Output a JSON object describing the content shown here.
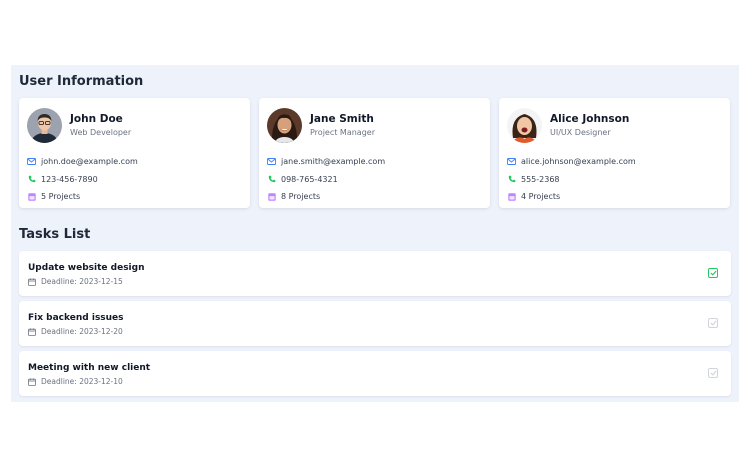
{
  "colors": {
    "panel_bg": "#eef2fb",
    "email_icon": "#3b82f6",
    "phone_icon": "#22c55e",
    "projects_icon": "#a855f7",
    "check_done": "#22c55e",
    "check_pending": "#d1d5db"
  },
  "users_section": {
    "title": "User Information"
  },
  "users": [
    {
      "name": "John Doe",
      "role": "Web Developer",
      "email": "john.doe@example.com",
      "phone": "123-456-7890",
      "projects": "5 Projects",
      "avatar_icon": "avatar-male-icon"
    },
    {
      "name": "Jane Smith",
      "role": "Project Manager",
      "email": "jane.smith@example.com",
      "phone": "098-765-4321",
      "projects": "8 Projects",
      "avatar_icon": "avatar-female-icon"
    },
    {
      "name": "Alice Johnson",
      "role": "UI/UX Designer",
      "email": "alice.johnson@example.com",
      "phone": "555-2368",
      "projects": "4 Projects",
      "avatar_icon": "avatar-female-icon"
    }
  ],
  "tasks_section": {
    "title": "Tasks List"
  },
  "tasks": [
    {
      "title": "Update website design",
      "deadline": "Deadline: 2023-12-15",
      "completed": true
    },
    {
      "title": "Fix backend issues",
      "deadline": "Deadline: 2023-12-20",
      "completed": false
    },
    {
      "title": "Meeting with new client",
      "deadline": "Deadline: 2023-12-10",
      "completed": false
    }
  ]
}
